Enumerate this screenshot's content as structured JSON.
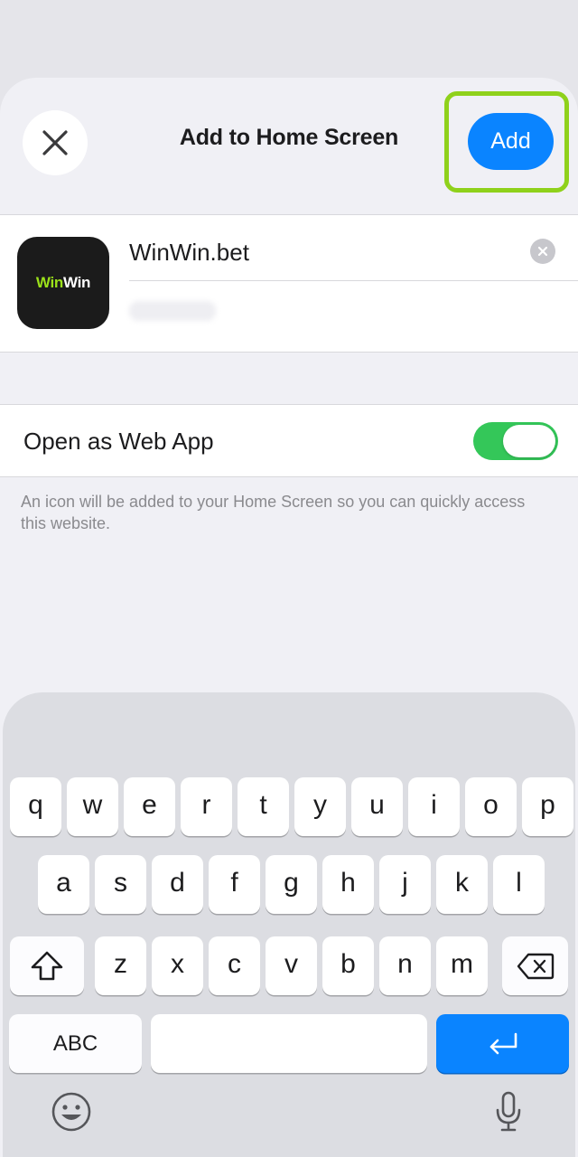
{
  "header": {
    "title": "Add to Home Screen",
    "add_label": "Add",
    "close_icon": "close-icon",
    "highlight_color": "#8fd11b"
  },
  "app": {
    "icon_text_left": "Win",
    "icon_text_right": "Win",
    "name_value": "WinWin.bet",
    "clear_icon": "clear-icon"
  },
  "web_app": {
    "label": "Open as Web App",
    "enabled": true
  },
  "footnote": "An icon will be added to your Home Screen so you can quickly access this website.",
  "keyboard": {
    "row1": [
      "q",
      "w",
      "e",
      "r",
      "t",
      "y",
      "u",
      "i",
      "o",
      "p"
    ],
    "row2": [
      "a",
      "s",
      "d",
      "f",
      "g",
      "h",
      "j",
      "k",
      "l"
    ],
    "row3": [
      "z",
      "x",
      "c",
      "v",
      "b",
      "n",
      "m"
    ],
    "abc_label": "ABC",
    "shift_icon": "shift-icon",
    "delete_icon": "delete-icon",
    "return_icon": "return-icon",
    "emoji_icon": "emoji-icon",
    "mic_icon": "microphone-icon"
  },
  "colors": {
    "accent": "#0a84ff",
    "toggle_on": "#34c759"
  }
}
